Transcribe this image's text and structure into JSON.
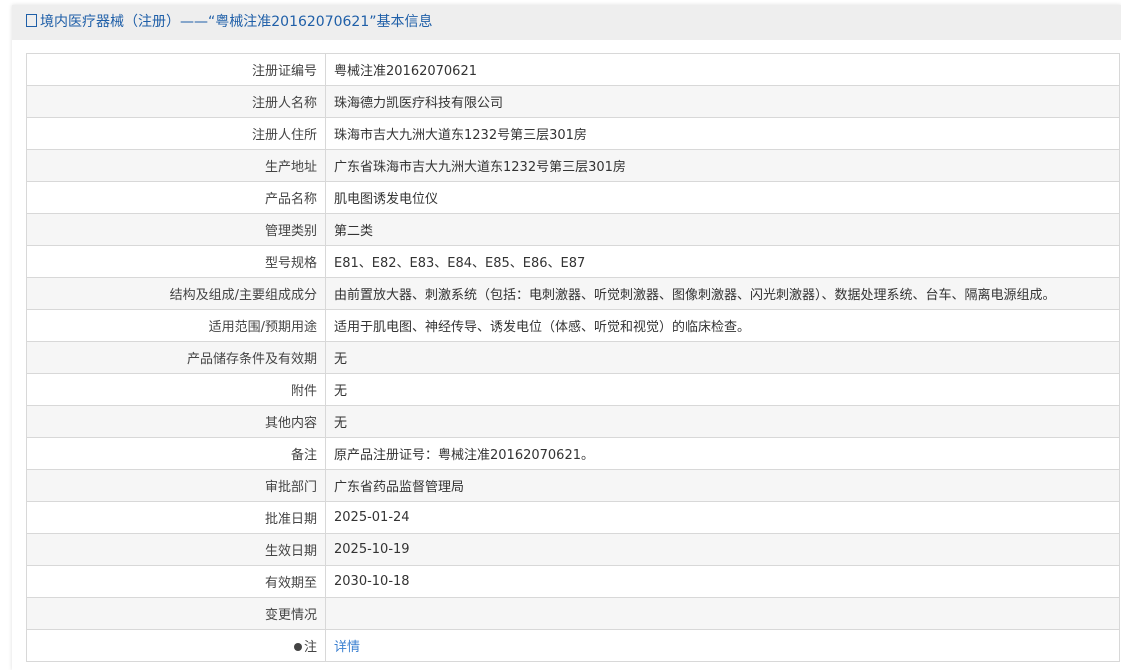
{
  "title": "境内医疗器械（注册）——“粤械注准20162070621”基本信息",
  "rows": [
    {
      "k": "注册证编号",
      "v": "粤械注准20162070621"
    },
    {
      "k": "注册人名称",
      "v": "珠海德力凯医疗科技有限公司"
    },
    {
      "k": "注册人住所",
      "v": "珠海市吉大九洲大道东1232号第三层301房"
    },
    {
      "k": "生产地址",
      "v": "广东省珠海市吉大九洲大道东1232号第三层301房"
    },
    {
      "k": "产品名称",
      "v": "肌电图诱发电位仪"
    },
    {
      "k": "管理类别",
      "v": "第二类"
    },
    {
      "k": "型号规格",
      "v": "E81、E82、E83、E84、E85、E86、E87"
    },
    {
      "k": "结构及组成/主要组成成分",
      "v": "由前置放大器、刺激系统（包括：电刺激器、听觉刺激器、图像刺激器、闪光刺激器）、数据处理系统、台车、隔离电源组成。"
    },
    {
      "k": "适用范围/预期用途",
      "v": "适用于肌电图、神经传导、诱发电位（体感、听觉和视觉）的临床检查。"
    },
    {
      "k": "产品储存条件及有效期",
      "v": "无"
    },
    {
      "k": "附件",
      "v": "无"
    },
    {
      "k": "其他内容",
      "v": "无"
    },
    {
      "k": "备注",
      "v": "原产品注册证号：粤械注准20162070621。"
    },
    {
      "k": "审批部门",
      "v": "广东省药品监督管理局"
    },
    {
      "k": "批准日期",
      "v": "2025-01-24"
    },
    {
      "k": "生效日期",
      "v": "2025-10-19"
    },
    {
      "k": "有效期至",
      "v": "2030-10-18"
    },
    {
      "k": "变更情况",
      "v": ""
    }
  ],
  "note": {
    "k": "注",
    "link": "详情"
  }
}
